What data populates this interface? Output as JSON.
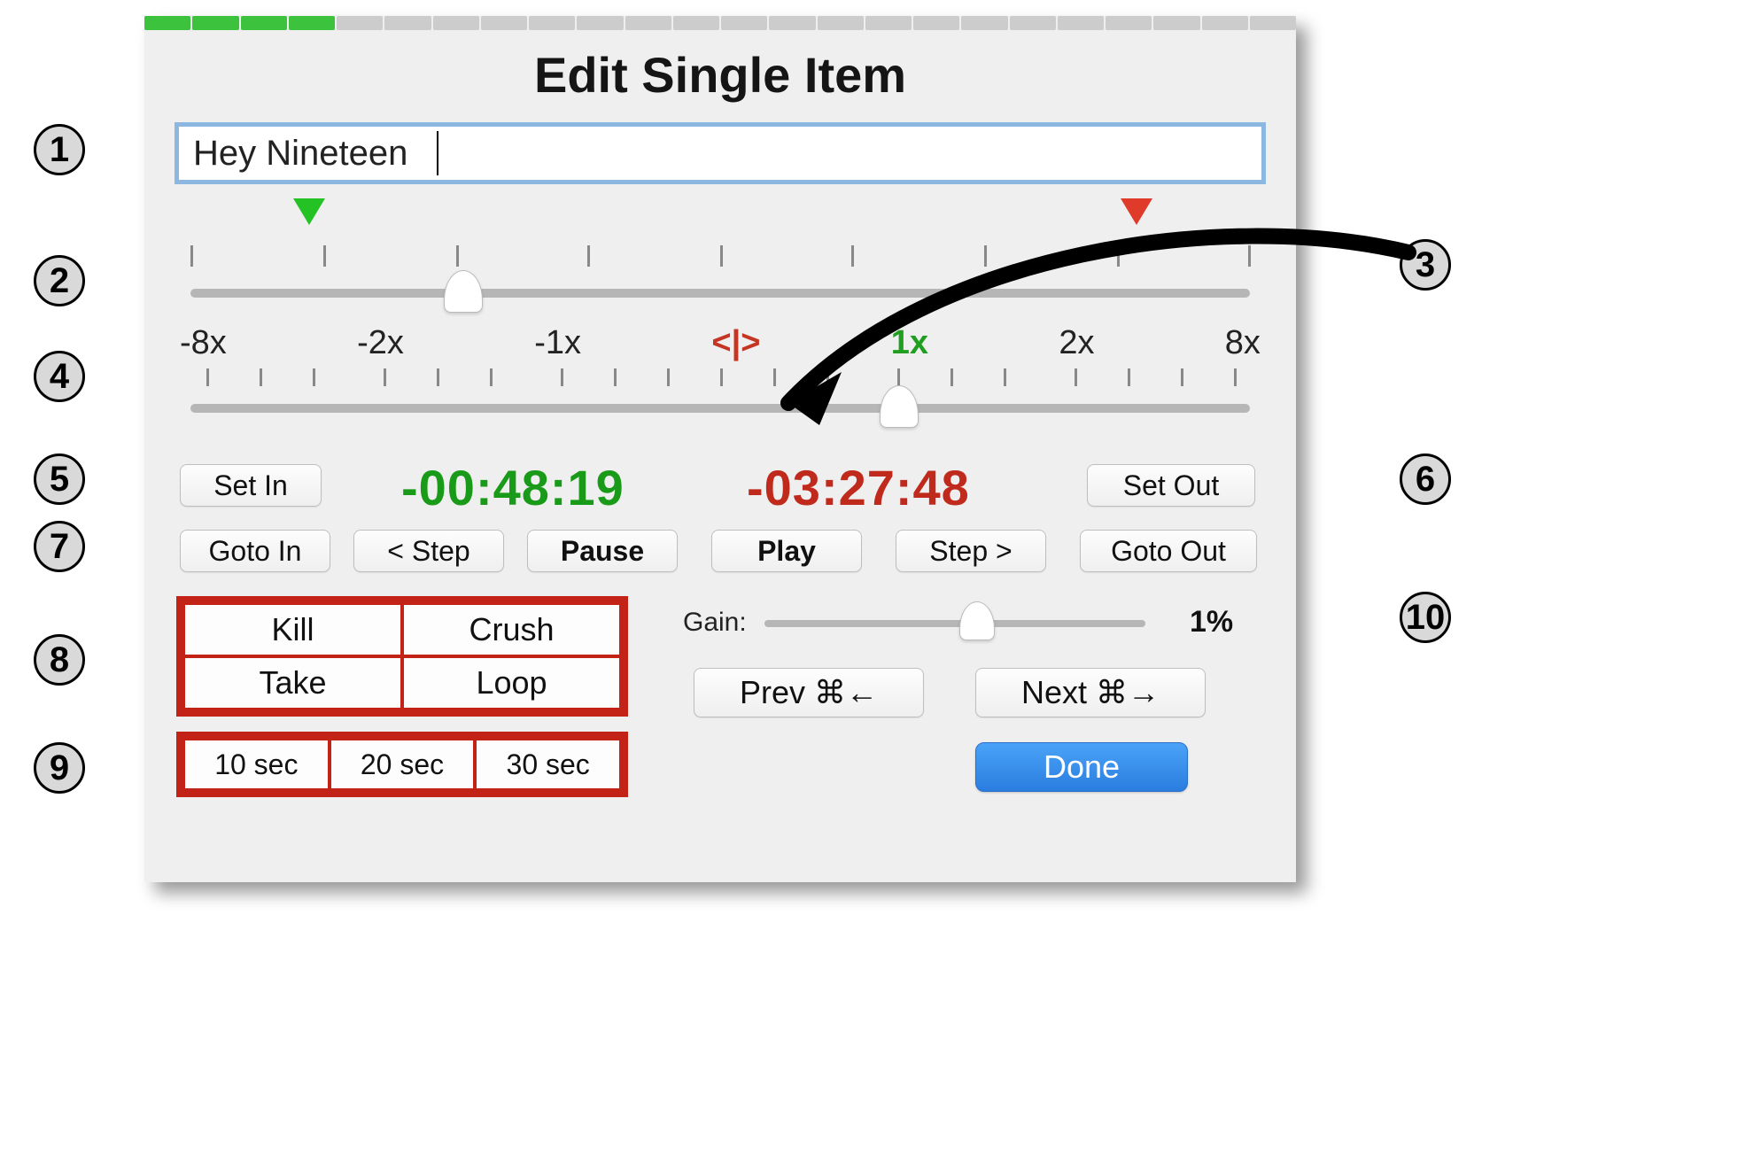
{
  "title": "Edit Single Item",
  "item_name": "Hey Nineteen",
  "position_slider": {
    "in_marker_pct": 11,
    "out_marker_pct": 90,
    "playhead_pct": 26
  },
  "speed_slider": {
    "labels": [
      "-8x",
      "-2x",
      "-1x",
      "<|>",
      "1x",
      "2x",
      "8x"
    ],
    "thumb_pct": 67
  },
  "time_in": "-00:48:19",
  "time_out": "-03:27:48",
  "buttons": {
    "set_in": "Set In",
    "set_out": "Set Out",
    "goto_in": "Goto In",
    "step_back": "< Step",
    "pause": "Pause",
    "play": "Play",
    "step_fwd": "Step >",
    "goto_out": "Goto Out",
    "prev": "Prev ⌘←",
    "next": "Next ⌘→",
    "done": "Done"
  },
  "action_grid": {
    "row1": [
      "Kill",
      "Crush"
    ],
    "row2": [
      "Take",
      "Loop"
    ],
    "durations": [
      "10 sec",
      "20 sec",
      "30 sec"
    ]
  },
  "gain": {
    "label": "Gain:",
    "value": "1%",
    "thumb_pct": 55
  },
  "callouts": {
    "c1": "1",
    "c2": "2",
    "c3": "3",
    "c4": "4",
    "c5": "5",
    "c6": "6",
    "c7": "7",
    "c8": "8",
    "c9": "9",
    "c10": "10"
  },
  "top_segments_active": 4,
  "top_segments_total": 24,
  "colors": {
    "in": "#199b19",
    "out": "#c02a1d",
    "accent_blue": "#2a7de0",
    "red_frame": "#c22316"
  }
}
